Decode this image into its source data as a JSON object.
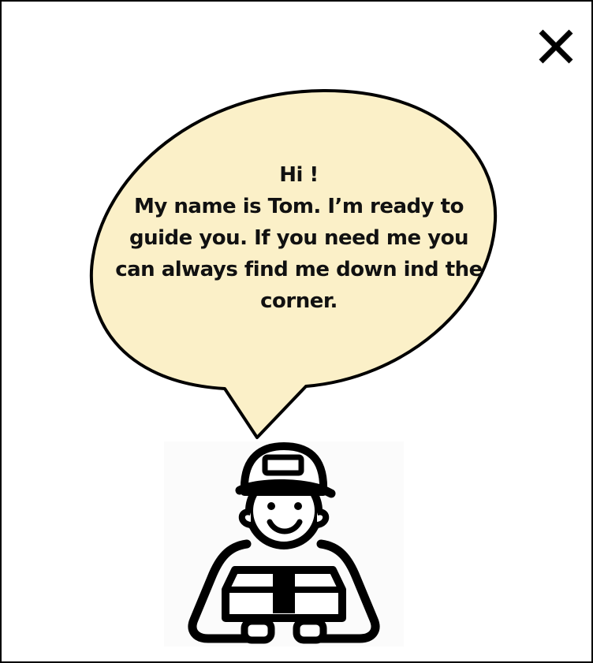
{
  "dialog": {
    "close_icon": "close-icon",
    "bubble_fill": "#fbf0c8",
    "greeting": "Hi !",
    "message_lines": [
      "My name is Tom. I’m ready to",
      "guide you. If you need me you",
      "can always find me down ind the",
      "corner."
    ],
    "mascot_icon": "delivery-man-with-package-icon"
  }
}
